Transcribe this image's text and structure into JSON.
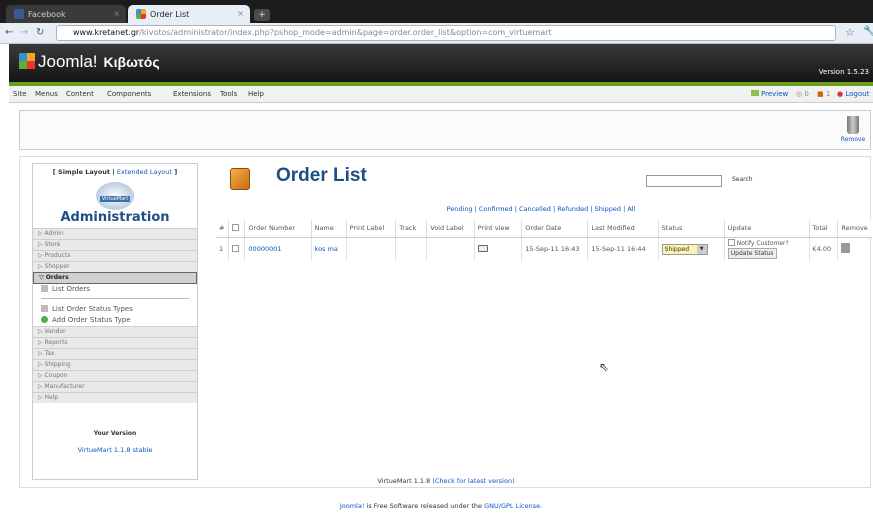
{
  "browser": {
    "tabs": [
      {
        "label": "Facebook"
      },
      {
        "label": "Order List"
      }
    ],
    "url_domain": "www.kretanet.gr",
    "url_path": "/kivotos/administrator/index.php?pshop_mode=admin&page=order.order_list&option=com_virtuemart"
  },
  "joomla": {
    "logo": "Joomla!",
    "site_name": "Κιβωτός",
    "version": "Version 1.5.23",
    "menu": [
      "Site",
      "Menus",
      "Content",
      "Components",
      "Extensions",
      "Tools",
      "Help"
    ],
    "right": {
      "preview": "Preview",
      "count1": "0",
      "count2": "1",
      "logout": "Logout"
    }
  },
  "toolbar": {
    "remove_label": "Remove"
  },
  "sidebar": {
    "layout_simple": "[ Simple Layout |",
    "layout_extended": "Extended Layout",
    "layout_end": "]",
    "logo_badge": "VirtueMart",
    "title": "Administration",
    "sections_top": [
      "Admin",
      "Store",
      "Products",
      "Shopper"
    ],
    "open_section": "Orders",
    "sub_items": [
      "List Orders",
      "List Order Status Types",
      "Add Order Status Type"
    ],
    "sections_bottom": [
      "Vendor",
      "Reports",
      "Tax",
      "Shipping",
      "Coupon",
      "Manufacturer",
      "Help"
    ],
    "your_version": "Your Version",
    "vm_version": "VirtueMart 1.1.8 stable"
  },
  "order_list": {
    "title": "Order List",
    "search_label": "Search",
    "filters": [
      "Pending",
      "Confirmed",
      "Cancelled",
      "Refunded",
      "Shipped",
      "All"
    ],
    "columns": [
      "#",
      "",
      "Order Number",
      "Name",
      "Print Label",
      "Track",
      "Void Label",
      "Print view",
      "Order Date",
      "Last Modified",
      "Status",
      "Update",
      "Total",
      "Remove"
    ],
    "rows": [
      {
        "num": "1",
        "order_number": "00000001",
        "name": "kos ma",
        "order_date": "15-Sep-11 16:43",
        "last_modified": "15-Sep-11 16:44",
        "status": "Shipped",
        "notify": "Notify Customer?",
        "update_btn": "Update Status",
        "total": "€4.00"
      }
    ]
  },
  "footer": {
    "vm_text": "VirtueMart 1.1.8",
    "vm_link": "(Check for latest version)",
    "joomla_link": "Joomla!",
    "joomla_text": "is Free Software released under the",
    "license_link": "GNU/GPL License."
  }
}
